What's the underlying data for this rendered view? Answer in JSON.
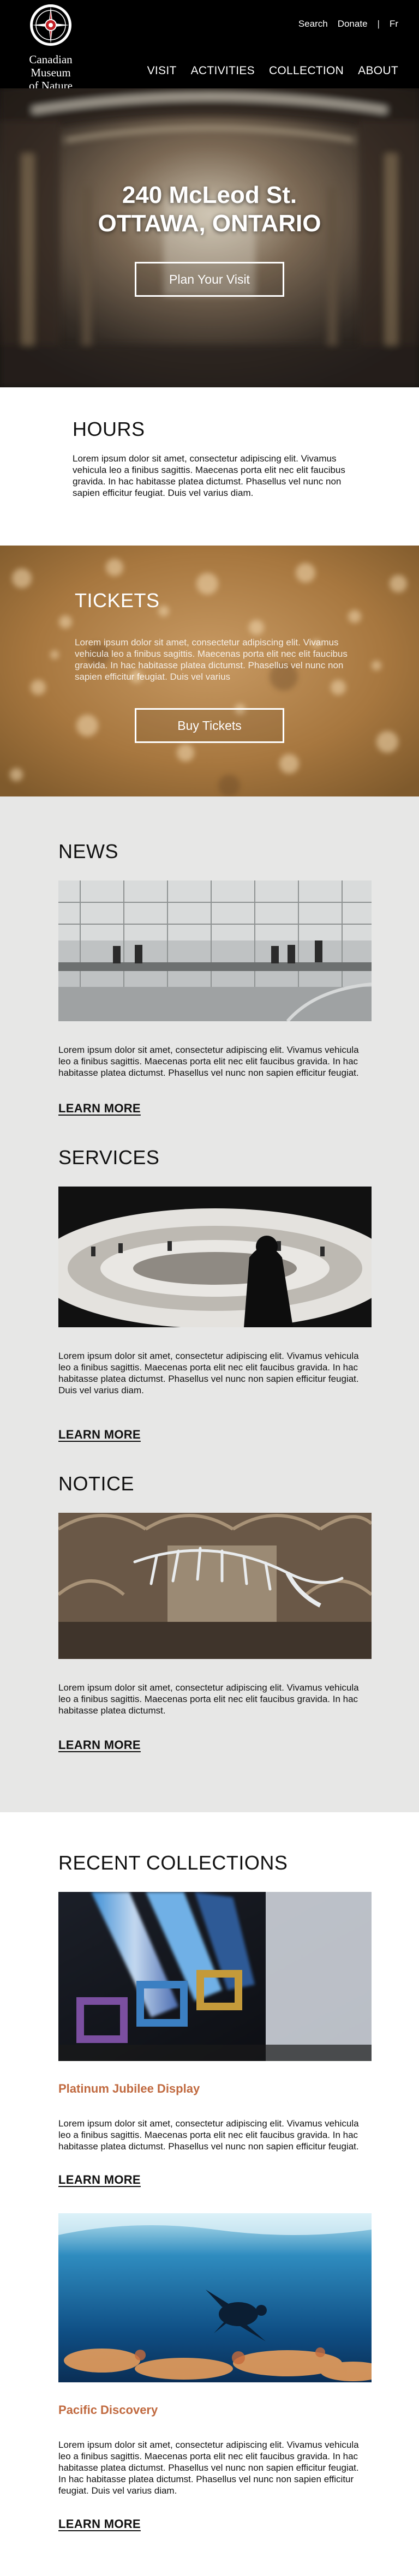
{
  "header": {
    "logo_line1": "Canadian Museum",
    "logo_line2": "of Nature",
    "util_search": "Search",
    "util_donate": "Donate",
    "util_separator": "|",
    "util_lang": "Fr",
    "nav": [
      "VISIT",
      "ACTIVITIES",
      "COLLECTION",
      "ABOUT"
    ]
  },
  "hero": {
    "address_line1": "240 McLeod St.",
    "address_line2": "OTTAWA, ONTARIO",
    "cta": "Plan Your Visit"
  },
  "hours": {
    "title": "HOURS",
    "text": "Lorem ipsum dolor sit amet, consectetur adipiscing elit. Vivamus vehicula leo a finibus sagittis. Maecenas porta elit nec elit faucibus gravida. In hac habitasse platea dictumst. Phasellus vel  nunc non sapien efficitur feugiat. Duis vel varius diam."
  },
  "tickets": {
    "title": "TICKETS",
    "text": "Lorem ipsum dolor sit amet, consectetur adipiscing elit. Vivamus vehicula leo a finibus sagittis. Maecenas porta elit nec elit faucibus gravida. In hac habitasse platea dictumst. Phasellus vel nunc non sapien efficitur feugiat. Duis vel varius",
    "cta": "Buy Tickets"
  },
  "news": {
    "title": "NEWS",
    "text": "Lorem ipsum dolor sit amet, consectetur adipiscing elit. Vivamus vehicula leo a finibus sagittis. Maecenas porta elit nec elit faucibus gravida. In hac habitasse platea dictumst. Phasellus vel nunc non sapien efficitur feugiat.",
    "link": "LEARN MORE"
  },
  "services": {
    "title": "SERVICES",
    "text": "Lorem ipsum dolor sit amet, consectetur adipiscing elit. Vivamus vehicula leo a finibus sagittis. Maecenas porta elit nec elit faucibus gravida. In hac habitasse platea dictumst. Phasellus vel nunc non sapien efficitur feugiat. Duis vel varius diam.",
    "link": "LEARN MORE"
  },
  "notice": {
    "title": "NOTICE",
    "text": "Lorem ipsum dolor sit amet, consectetur adipiscing elit. Vivamus vehicula leo a finibus sagittis. Maecenas porta elit nec elit faucibus gravida. In hac habitasse platea dictumst.",
    "link": "LEARN MORE"
  },
  "collections": {
    "title": "RECENT COLLECTIONS",
    "items": [
      {
        "title": "Platinum Jubilee Display",
        "text": "Lorem ipsum dolor sit amet, consectetur adipiscing elit. Vivamus vehicula leo a finibus sagittis. Maecenas porta elit nec elit faucibus gravida. In hac habitasse platea dictumst. Phasellus vel nunc non sapien efficitur feugiat.",
        "link": "LEARN MORE"
      },
      {
        "title": "Pacific Discovery",
        "text": "Lorem ipsum dolor sit amet, consectetur adipiscing elit. Vivamus vehicula leo a finibus sagittis. Maecenas porta elit nec elit faucibus gravida. In hac habitasse platea dictumst. Phasellus vel nunc non sapien efficitur feugiat. In hac habitasse platea dictumst. Phasellus vel nunc non sapien efficitur feugiat. Duis vel varius diam.",
        "link": "LEARN MORE"
      }
    ]
  },
  "colors": {
    "header_bg": "#000000",
    "feed_bg": "#e7e7e6",
    "collection_title": "#c0693f"
  }
}
